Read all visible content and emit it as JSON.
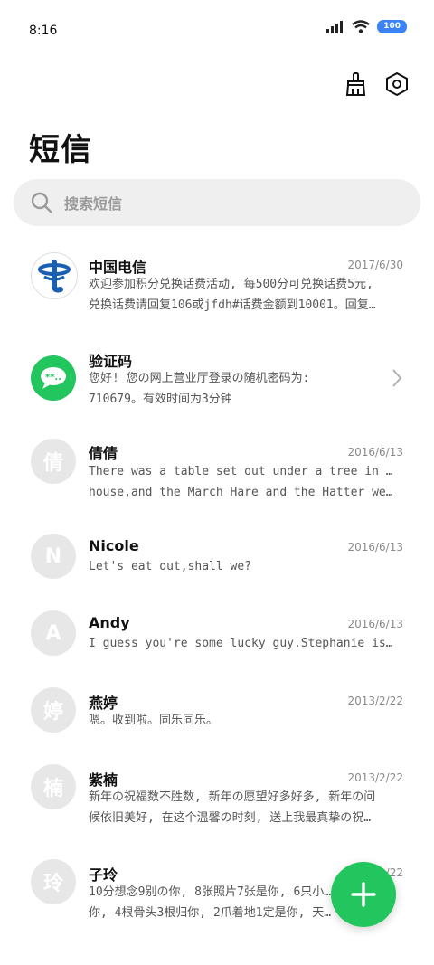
{
  "status_bar": {
    "time": "8:16",
    "battery": "100",
    "icons": [
      "signal-icon",
      "wifi-icon",
      "battery-icon"
    ]
  },
  "header": {
    "title": "短信",
    "actions": [
      "clean-brush-icon",
      "settings-hex-icon"
    ]
  },
  "search": {
    "placeholder": "搜索短信"
  },
  "messages": [
    {
      "name": "中国电信",
      "date": "2017/6/30",
      "line1": "欢迎参加积分兑换话费活动, 每500分可兑换话费5元,",
      "line2": "兑换话费请回复106或jfdh#话费金额到10001。回复…",
      "avatar": "china-telecom-logo"
    },
    {
      "name": "验证码",
      "date": "",
      "line1": "您好! 您の网上营业厅登录の随机密码为:",
      "line2": "710679。有效时间为3分钟",
      "avatar": "message-bubble-icon"
    },
    {
      "name": "倩倩",
      "date": "2016/6/13",
      "line1": "There was a table set out under a tree in front of the",
      "line2": "house,and the March Hare and the Hatter were havin…",
      "avatar": "倩"
    },
    {
      "name": "Nicole",
      "date": "2016/6/13",
      "line1": "Let's eat out,shall we?",
      "line2": "",
      "avatar": "N"
    },
    {
      "name": "Andy",
      "date": "2016/6/13",
      "line1": "I guess you're some lucky guy.Stephanie is a nice girl.",
      "line2": "",
      "avatar": "A"
    },
    {
      "name": "燕婷",
      "date": "2013/2/22",
      "line1": "嗯。收到啦。同乐同乐。",
      "line2": "",
      "avatar": "婷"
    },
    {
      "name": "紫楠",
      "date": "2013/2/22",
      "line1": "新年の祝福数不胜数, 新年の愿望好多好多, 新年の问",
      "line2": "候依旧美好, 在这个温馨の时刻, 送上我最真挚の祝…",
      "avatar": "楠"
    },
    {
      "name": "子玲",
      "date": "2013/2/22",
      "line1": "10分想念9别の你, 8张照片7张是你, 6只小…",
      "line2": "你, 4根骨头3根归你, 2爪着地1定是你, 天…",
      "avatar": "玲"
    }
  ],
  "fab": {
    "icon": "plus-icon",
    "color": "#22c55e"
  }
}
